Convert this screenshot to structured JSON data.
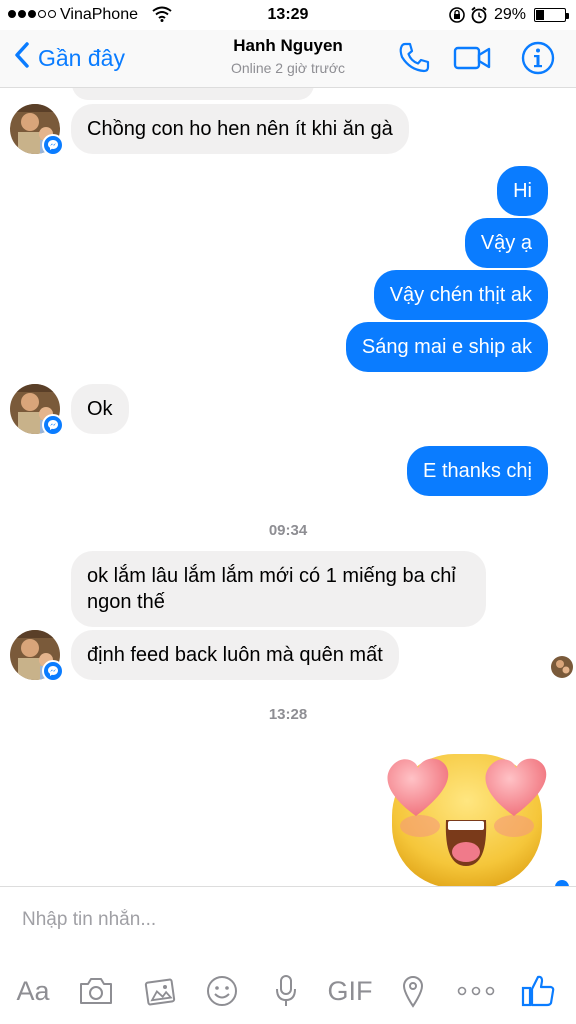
{
  "status_bar": {
    "carrier": "VinaPhone",
    "time": "13:29",
    "battery_percent": "29%",
    "battery_level": 0.29
  },
  "header": {
    "back_label": "Gần đây",
    "contact_name": "Hanh Nguyen",
    "contact_status": "Online 2 giờ trước"
  },
  "messages": [
    {
      "from": "them",
      "text": "Chồng con ho hen nên ít khi ăn gà"
    },
    {
      "from": "me",
      "text": "Hi"
    },
    {
      "from": "me",
      "text": "Vậy ạ"
    },
    {
      "from": "me",
      "text": "Vậy chén thịt ak"
    },
    {
      "from": "me",
      "text": "Sáng mai e ship ak"
    },
    {
      "from": "them",
      "text": "Ok"
    },
    {
      "from": "me",
      "text": "E thanks chị"
    },
    {
      "type": "timestamp",
      "text": "09:34"
    },
    {
      "from": "them",
      "text": "ok lắm lâu lắm lắm mới có 1 miếng ba chỉ ngon thế"
    },
    {
      "from": "them",
      "text": "định feed back luôn mà quên mất"
    },
    {
      "type": "timestamp",
      "text": "13:28"
    },
    {
      "from": "me",
      "sticker": "heart-eyes-emoji"
    }
  ],
  "composer": {
    "placeholder": "Nhập tin nhắn...",
    "text_button": "Aa",
    "gif_button": "GIF"
  },
  "icons": {
    "back": "chevron-left-icon",
    "call": "phone-icon",
    "video": "video-camera-icon",
    "info": "info-icon",
    "camera": "camera-icon",
    "gallery": "image-icon",
    "emoji": "smiley-icon",
    "mic": "microphone-icon",
    "location": "location-pin-icon",
    "more": "more-dots-icon",
    "like": "thumbs-up-icon"
  },
  "colors": {
    "accent": "#0a7cff",
    "incoming_bubble": "#f1f0f0"
  }
}
